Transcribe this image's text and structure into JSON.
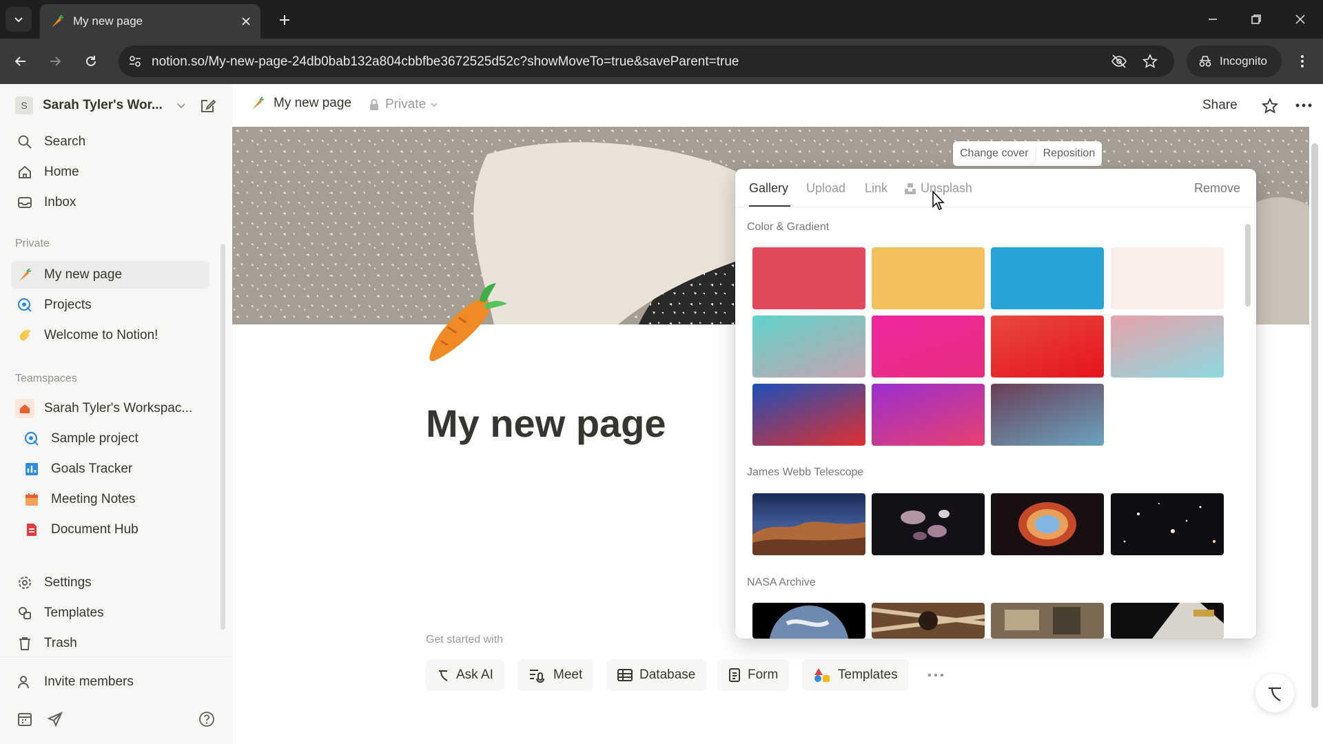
{
  "browser": {
    "tab_title": "My new page",
    "url": "notion.so/My-new-page-24db0bab132a804cbbfbe3672525d52c?showMoveTo=true&saveParent=true",
    "incognito_label": "Incognito"
  },
  "sidebar": {
    "workspace_initial": "S",
    "workspace_name": "Sarah Tyler's Wor...",
    "nav": [
      {
        "label": "Search",
        "icon": "search-icon"
      },
      {
        "label": "Home",
        "icon": "home-icon"
      },
      {
        "label": "Inbox",
        "icon": "inbox-icon"
      }
    ],
    "private_heading": "Private",
    "private_items": [
      {
        "label": "My new page",
        "icon": "carrot-icon"
      },
      {
        "label": "Projects",
        "icon": "projects-icon"
      },
      {
        "label": "Welcome to Notion!",
        "icon": "wave-icon"
      }
    ],
    "teamspaces_heading": "Teamspaces",
    "teamspace_name": "Sarah Tyler's Workspac...",
    "teamspace_items": [
      {
        "label": "Sample project",
        "icon": "projects-icon"
      },
      {
        "label": "Goals Tracker",
        "icon": "chart-icon"
      },
      {
        "label": "Meeting Notes",
        "icon": "calendar-icon"
      },
      {
        "label": "Document Hub",
        "icon": "document-icon"
      }
    ],
    "bottom": [
      {
        "label": "Settings",
        "icon": "gear-icon"
      },
      {
        "label": "Templates",
        "icon": "templates-icon"
      },
      {
        "label": "Trash",
        "icon": "trash-icon"
      }
    ],
    "invite_label": "Invite members"
  },
  "topbar": {
    "breadcrumb_title": "My new page",
    "privacy_label": "Private",
    "share_label": "Share"
  },
  "cover": {
    "change_cover_label": "Change cover",
    "reposition_label": "Reposition"
  },
  "page": {
    "title": "My new page",
    "get_started_label": "Get started with",
    "actions": [
      {
        "label": "Ask AI",
        "icon": "ai-icon"
      },
      {
        "label": "Meet",
        "icon": "meet-icon"
      },
      {
        "label": "Database",
        "icon": "table-icon"
      },
      {
        "label": "Form",
        "icon": "form-icon"
      },
      {
        "label": "Templates",
        "icon": "templates-color-icon"
      }
    ]
  },
  "popover": {
    "tabs": [
      {
        "label": "Gallery",
        "active": true
      },
      {
        "label": "Upload",
        "active": false
      },
      {
        "label": "Link",
        "active": false
      },
      {
        "label": "Unsplash",
        "active": false
      }
    ],
    "remove_label": "Remove",
    "sections": [
      {
        "heading": "Color & Gradient"
      },
      {
        "heading": "James Webb Telescope"
      },
      {
        "heading": "NASA Archive"
      }
    ],
    "colors": [
      "#e04a5b",
      "#f2c15a",
      "#27a1d6",
      "#fbeee8"
    ],
    "gradients": [
      [
        "#5fd3c8",
        "#c6a3b0"
      ],
      [
        "#f026a0",
        "#e82d7d"
      ],
      [
        "#e8493f",
        "#e5141c"
      ],
      [
        "#e8a1a9",
        "#8dd9e0"
      ],
      [
        "#1e4fb8",
        "#e03030"
      ],
      [
        "#9a2fd0",
        "#e8406e"
      ],
      [
        "#6a3f56",
        "#6aa3c0"
      ]
    ]
  }
}
